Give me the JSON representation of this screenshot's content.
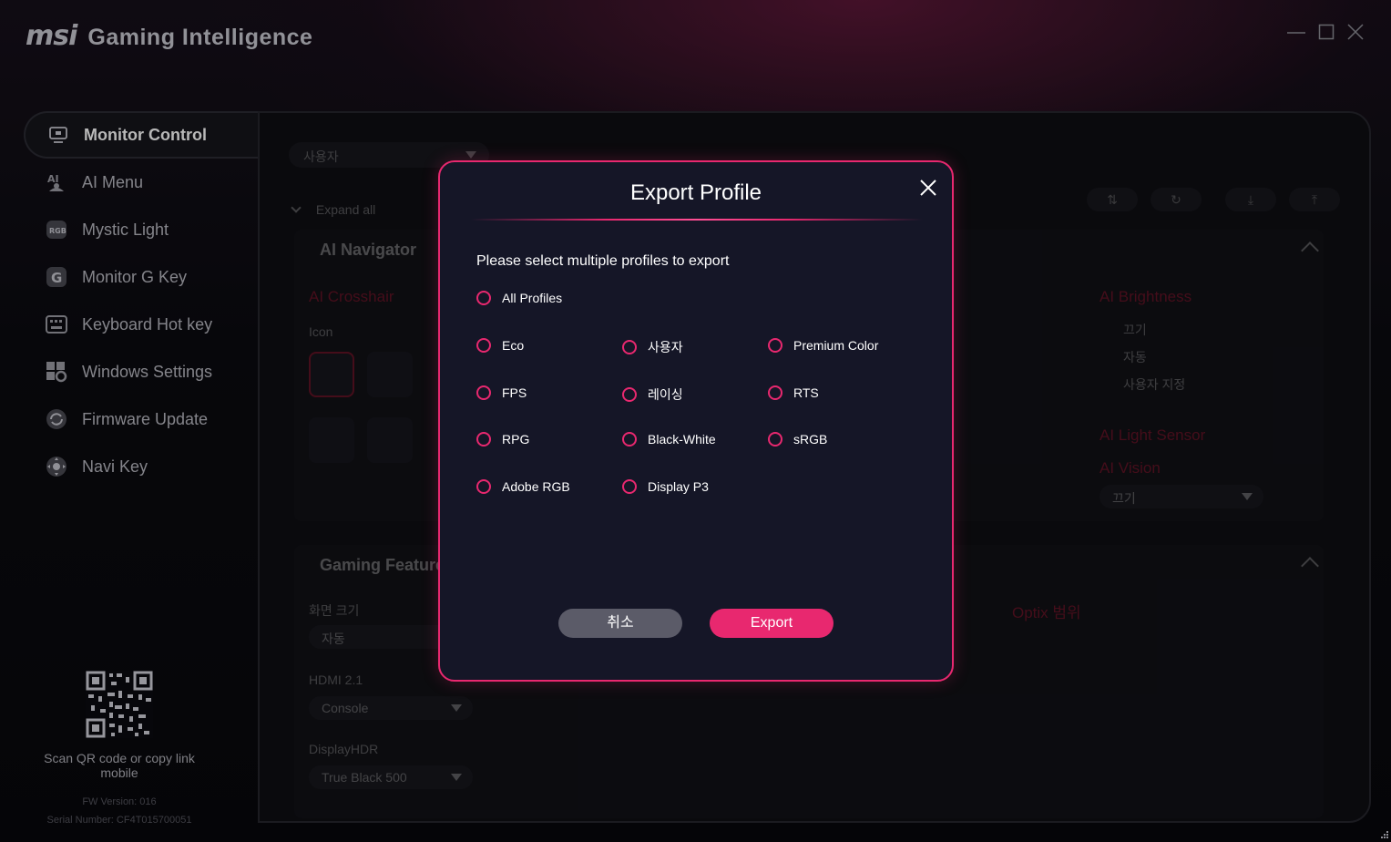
{
  "app": {
    "brand": "msi",
    "product": "Gaming Intelligence"
  },
  "sidebar": {
    "items": [
      {
        "label": "Monitor Control",
        "icon": "monitor-icon"
      },
      {
        "label": "AI Menu",
        "icon": "ai-menu-icon"
      },
      {
        "label": "Mystic Light",
        "icon": "rgb-icon"
      },
      {
        "label": "Monitor G Key",
        "icon": "g-key-icon"
      },
      {
        "label": "Keyboard Hot key",
        "icon": "keyboard-icon"
      },
      {
        "label": "Windows Settings",
        "icon": "windows-settings-icon"
      },
      {
        "label": "Firmware Update",
        "icon": "firmware-update-icon"
      },
      {
        "label": "Navi Key",
        "icon": "navi-key-icon"
      }
    ],
    "qr_caption": "Scan QR code or copy link mobile",
    "fw_version": "FW Version: 016",
    "serial": "Serial Number: CF4T015700051"
  },
  "main": {
    "profile_select": "사용자",
    "expand_all": "Expand all",
    "ai_navigator": {
      "title": "AI Navigator",
      "ai_crosshair": "AI Crosshair",
      "icon_label": "Icon",
      "ai_brightness": "AI Brightness",
      "brightness_options": [
        "끄기",
        "자동",
        "사용자 지정"
      ],
      "ai_light_sensor": "AI Light Sensor",
      "ai_vision": "AI Vision",
      "ai_vision_value": "끄기"
    },
    "gaming_feature": {
      "title": "Gaming Feature",
      "screen_size_label": "화면 크기",
      "screen_size_value": "자동",
      "hdmi_label": "HDMI 2.1",
      "hdmi_value": "Console",
      "displayhdr_label": "DisplayHDR",
      "displayhdr_value": "True Black 500",
      "optix_scope": "Optix 범위"
    }
  },
  "modal": {
    "title": "Export Profile",
    "instruction": "Please select multiple profiles to export",
    "all_profiles": "All Profiles",
    "profiles": [
      "Eco",
      "사용자",
      "Premium Color",
      "FPS",
      "레이싱",
      "RTS",
      "RPG",
      "Black-White",
      "sRGB",
      "Adobe RGB",
      "Display P3"
    ],
    "cancel_label": "취소",
    "export_label": "Export"
  },
  "colors": {
    "accent": "#e8286f",
    "modal_bg": "#151627",
    "crimson": "#d11a3c"
  }
}
